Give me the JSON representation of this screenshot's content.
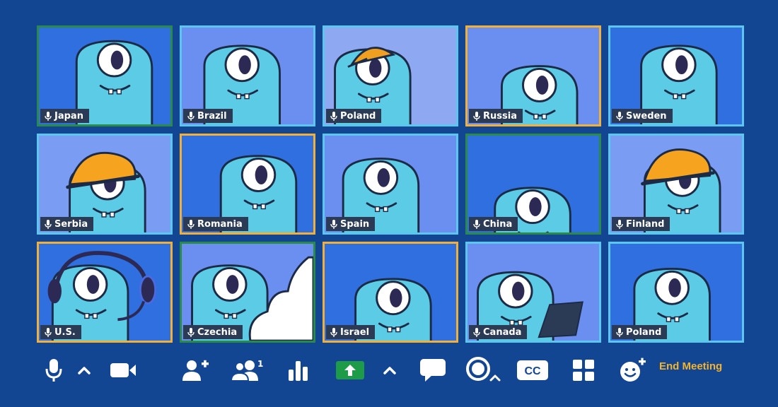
{
  "colors": {
    "background": "#124592",
    "border_default": "#5cc6ee",
    "border_orange": "#f0b03a",
    "border_green": "#2a8a4a",
    "monster": "#5ccce6",
    "outline": "#1c2a45",
    "label_bg": "#2b3a55",
    "end_meeting": "#f3b32b",
    "share_green": "#1e9b48"
  },
  "participants": [
    {
      "name": "Japan",
      "border": "green",
      "bg": "#2f6fe0"
    },
    {
      "name": "Brazil",
      "border": "default",
      "bg": "#6a8ff0"
    },
    {
      "name": "Poland",
      "border": "default",
      "bg": "#8ea8f2",
      "accessory": "cap"
    },
    {
      "name": "Russia",
      "border": "orange",
      "bg": "#6a8ff0"
    },
    {
      "name": "Sweden",
      "border": "default",
      "bg": "#2f6fe0"
    },
    {
      "name": "Serbia",
      "border": "default",
      "bg": "#7a9cf2",
      "accessory": "hardhat"
    },
    {
      "name": "Romania",
      "border": "orange",
      "bg": "#2f6fe0"
    },
    {
      "name": "Spain",
      "border": "default",
      "bg": "#6a8ff0"
    },
    {
      "name": "China",
      "border": "green",
      "bg": "#2f6fe0"
    },
    {
      "name": "Finland",
      "border": "default",
      "bg": "#7a9cf2",
      "accessory": "hardhat"
    },
    {
      "name": "U.S.",
      "border": "orange",
      "bg": "#2f6fe0",
      "accessory": "headset"
    },
    {
      "name": "Czechia",
      "border": "green",
      "bg": "#6a8ff0",
      "accessory": "cloud"
    },
    {
      "name": "Israel",
      "border": "orange",
      "bg": "#2f6fe0"
    },
    {
      "name": "Canada",
      "border": "default",
      "bg": "#6a8ff0",
      "accessory": "laptop"
    },
    {
      "name": "Poland",
      "border": "default",
      "bg": "#2f6fe0"
    }
  ],
  "toolbar": {
    "icons": [
      "microphone-icon",
      "chevron-up-icon",
      "video-camera-icon",
      "add-participant-icon",
      "participants-icon",
      "poll-icon",
      "share-screen-icon",
      "chevron-up-icon",
      "chat-icon",
      "record-icon",
      "closed-captions-icon",
      "gallery-view-icon",
      "reactions-icon"
    ],
    "participants_count": "1",
    "cc_label": "CC",
    "end_label": "End Meeting"
  }
}
